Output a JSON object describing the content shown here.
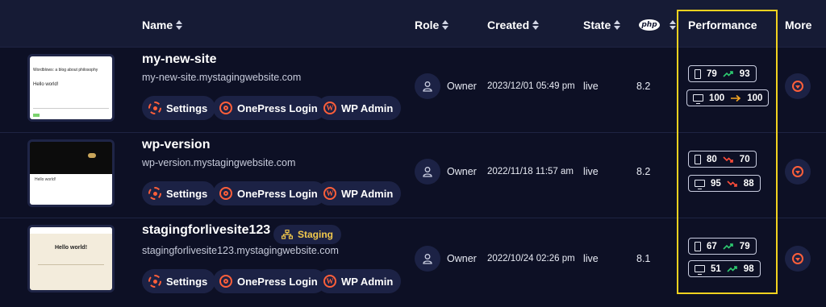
{
  "header": {
    "name": "Name",
    "role": "Role",
    "created": "Created",
    "state": "State",
    "php_badge": "php",
    "performance": "Performance",
    "more": "More"
  },
  "buttons": {
    "settings": "Settings",
    "onepress": "OnePress Login",
    "wpadmin": "WP Admin"
  },
  "rows": [
    {
      "name": "my-new-site",
      "url": "my-new-site.mystagingwebsite.com",
      "role": "Owner",
      "created": "2023/12/01 05:49 pm",
      "state": "live",
      "php": "8.2",
      "thumb_text": "Wordblows: a blog about philosophy",
      "thumb_text2": "Hello world!",
      "perf": {
        "mobile": {
          "from": "79",
          "to": "93",
          "trend": "up",
          "trend_color": "#2ecc71"
        },
        "desktop": {
          "from": "100",
          "to": "100",
          "trend": "flat",
          "trend_color": "#f5a623"
        }
      }
    },
    {
      "name": "wp-version",
      "url": "wp-version.mystagingwebsite.com",
      "role": "Owner",
      "created": "2022/11/18 11:57 am",
      "state": "live",
      "php": "8.2",
      "thumb_text2": "Hello world!",
      "perf": {
        "mobile": {
          "from": "80",
          "to": "70",
          "trend": "down",
          "trend_color": "#ff4d3a"
        },
        "desktop": {
          "from": "95",
          "to": "88",
          "trend": "down",
          "trend_color": "#ff4d3a"
        }
      }
    },
    {
      "name": "stagingforlivesite123",
      "badge": "Staging",
      "url": "stagingforlivesite123.mystagingwebsite.com",
      "role": "Owner",
      "created": "2022/10/24 02:26 pm",
      "state": "live",
      "php": "8.1",
      "thumb_text2": "Hello world!",
      "perf": {
        "mobile": {
          "from": "67",
          "to": "79",
          "trend": "up",
          "trend_color": "#2ecc71"
        },
        "desktop": {
          "from": "51",
          "to": "98",
          "trend": "up",
          "trend_color": "#2ecc71"
        }
      }
    }
  ],
  "colors": {
    "accent": "#ff5f3a",
    "highlight": "#f2d21f",
    "background": "#0d1025",
    "header_bg": "#161b35"
  }
}
